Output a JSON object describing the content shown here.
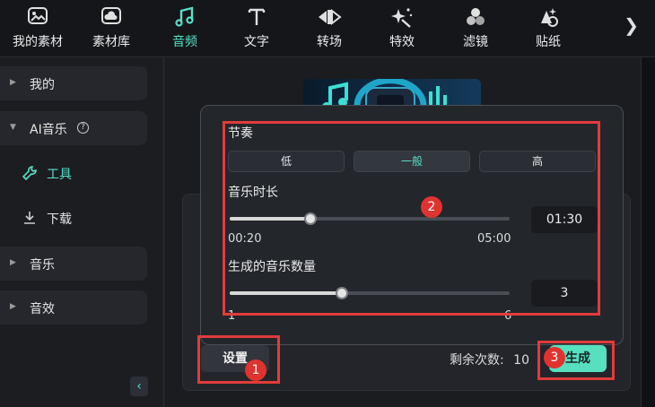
{
  "toolbar": {
    "items": [
      {
        "label": "我的素材",
        "icon": "my-media-icon"
      },
      {
        "label": "素材库",
        "icon": "library-icon"
      },
      {
        "label": "音频",
        "icon": "music-note-icon",
        "active": true
      },
      {
        "label": "文字",
        "icon": "text-icon"
      },
      {
        "label": "转场",
        "icon": "transition-icon"
      },
      {
        "label": "特效",
        "icon": "effects-icon"
      },
      {
        "label": "滤镜",
        "icon": "filters-icon"
      },
      {
        "label": "贴纸",
        "icon": "stickers-icon"
      }
    ],
    "more": "❯"
  },
  "sidebar": {
    "my": "我的",
    "ai_music": "AI音乐",
    "ai_help": "?",
    "tools": "工具",
    "download": "下载",
    "music": "音乐",
    "sfx": "音效",
    "collapse": "‹"
  },
  "popup": {
    "rhythm": {
      "label": "节奏",
      "options": [
        "低",
        "一般",
        "高"
      ],
      "selected": "一般"
    },
    "duration": {
      "label": "音乐时长",
      "value": "01:30",
      "min_label": "00:20",
      "max_label": "05:00",
      "fraction": 0.29
    },
    "count": {
      "label": "生成的音乐数量",
      "value": "3",
      "min_label": "1",
      "max_label": "6",
      "fraction": 0.4
    }
  },
  "actions": {
    "settings": "设置",
    "remaining_label": "剩余次数:",
    "remaining_value": "10",
    "generate": "生成"
  },
  "annotations": {
    "badge_1": "1",
    "badge_2": "2",
    "badge_3": "3"
  },
  "colors": {
    "accent": "#57e0c7",
    "annotation_red": "#e23b3b"
  }
}
